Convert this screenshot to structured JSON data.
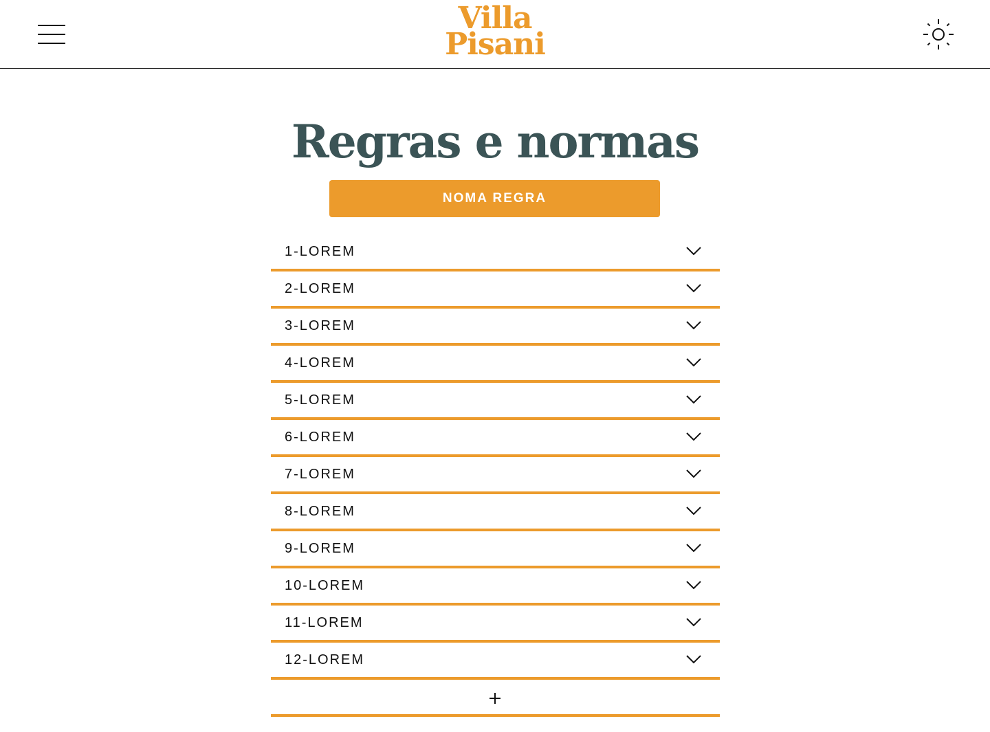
{
  "colors": {
    "accent": "#ec9b2c",
    "title": "#3b5456",
    "text": "#111111",
    "border": "#1a1a1a"
  },
  "header": {
    "logo_line1": "Villa",
    "logo_line2": "Pisani",
    "menu_icon": "hamburger-menu-icon",
    "theme_icon": "sun-icon"
  },
  "main": {
    "title": "Regras e normas",
    "add_rule_button": "NOMA REGRA",
    "rules": [
      {
        "label": "1-LOREM"
      },
      {
        "label": "2-LOREM"
      },
      {
        "label": "3-LOREM"
      },
      {
        "label": "4-LOREM"
      },
      {
        "label": "5-LOREM"
      },
      {
        "label": "6-LOREM"
      },
      {
        "label": "7-LOREM"
      },
      {
        "label": "8-LOREM"
      },
      {
        "label": "9-LOREM"
      },
      {
        "label": "10-LOREM"
      },
      {
        "label": "11-LOREM"
      },
      {
        "label": "12-LOREM"
      }
    ],
    "add_row_icon": "plus-icon"
  }
}
